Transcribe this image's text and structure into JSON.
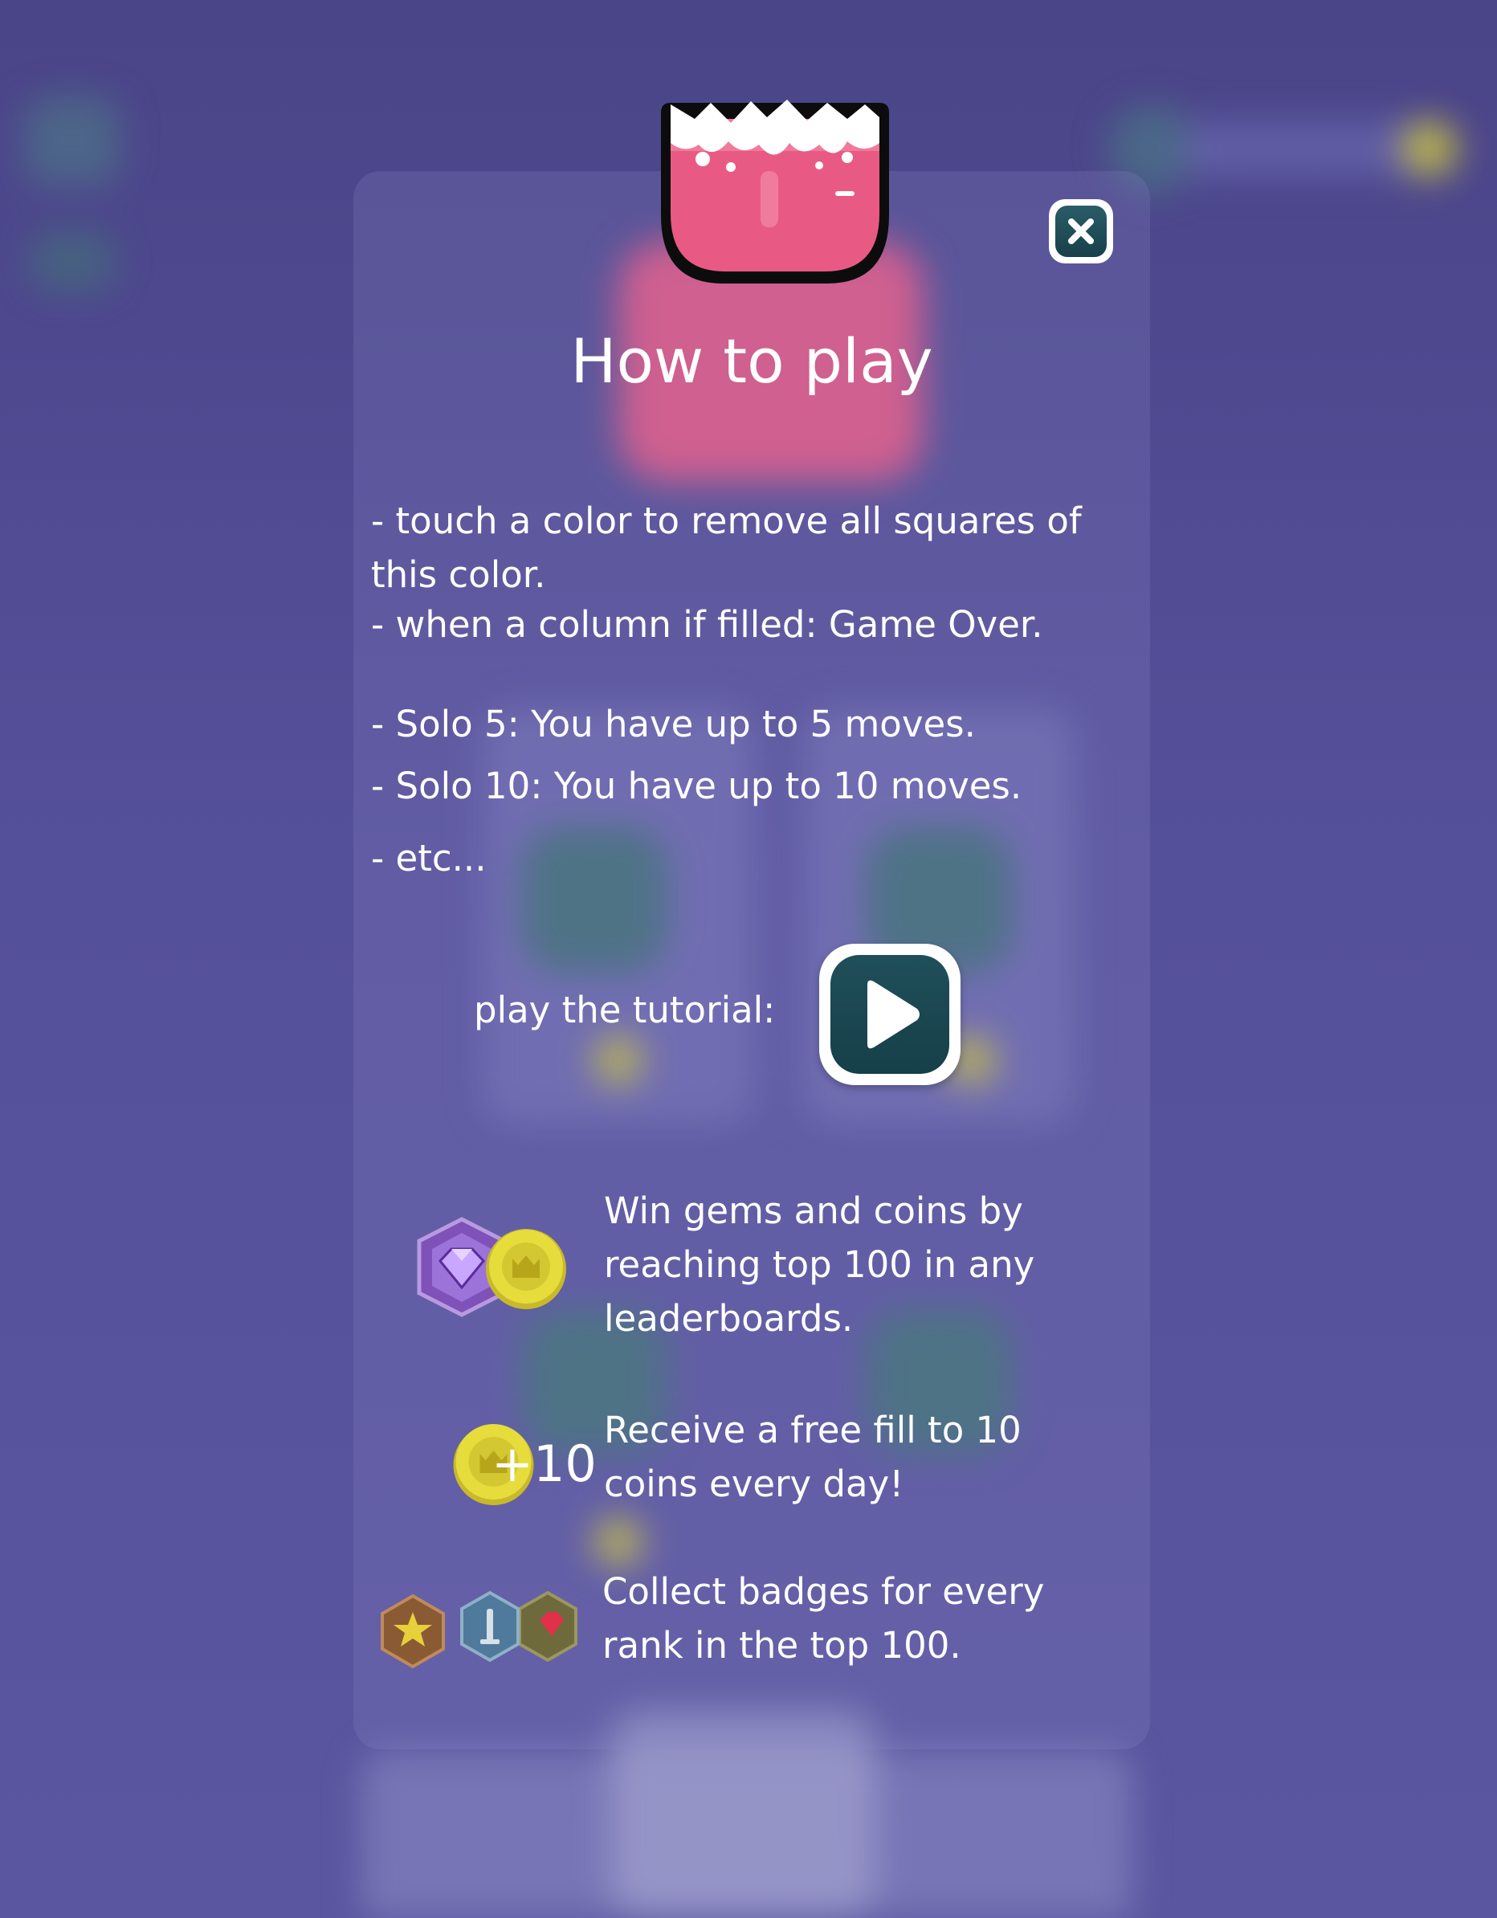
{
  "modal": {
    "title": "How to play",
    "rules": [
      "- touch a color to remove all squares of this color.",
      "- when a column if filled: Game Over.",
      "- Solo 5: You have up to 5 moves.",
      "- Solo 10: You have up to 10 moves.",
      "- etc..."
    ],
    "tutorial_label": "play the tutorial:",
    "rewards": [
      {
        "text": "Win gems and coins by reaching top 100 in any leaderboards.",
        "icon": "gem-and-coin-icon"
      },
      {
        "text": "Receive a free fill to 10 coins every day!",
        "icon": "coin-icon",
        "amount": "+10"
      },
      {
        "text": "Collect badges for every rank in the top 100.",
        "icon": "rank-badges-icon"
      }
    ]
  },
  "colors": {
    "background": "#4a4488",
    "bucket_pink": "#e85a84",
    "button_teal": "#1f4f5a",
    "coin_yellow": "#e6dd3c",
    "gem_purple": "#8a5cc8"
  }
}
